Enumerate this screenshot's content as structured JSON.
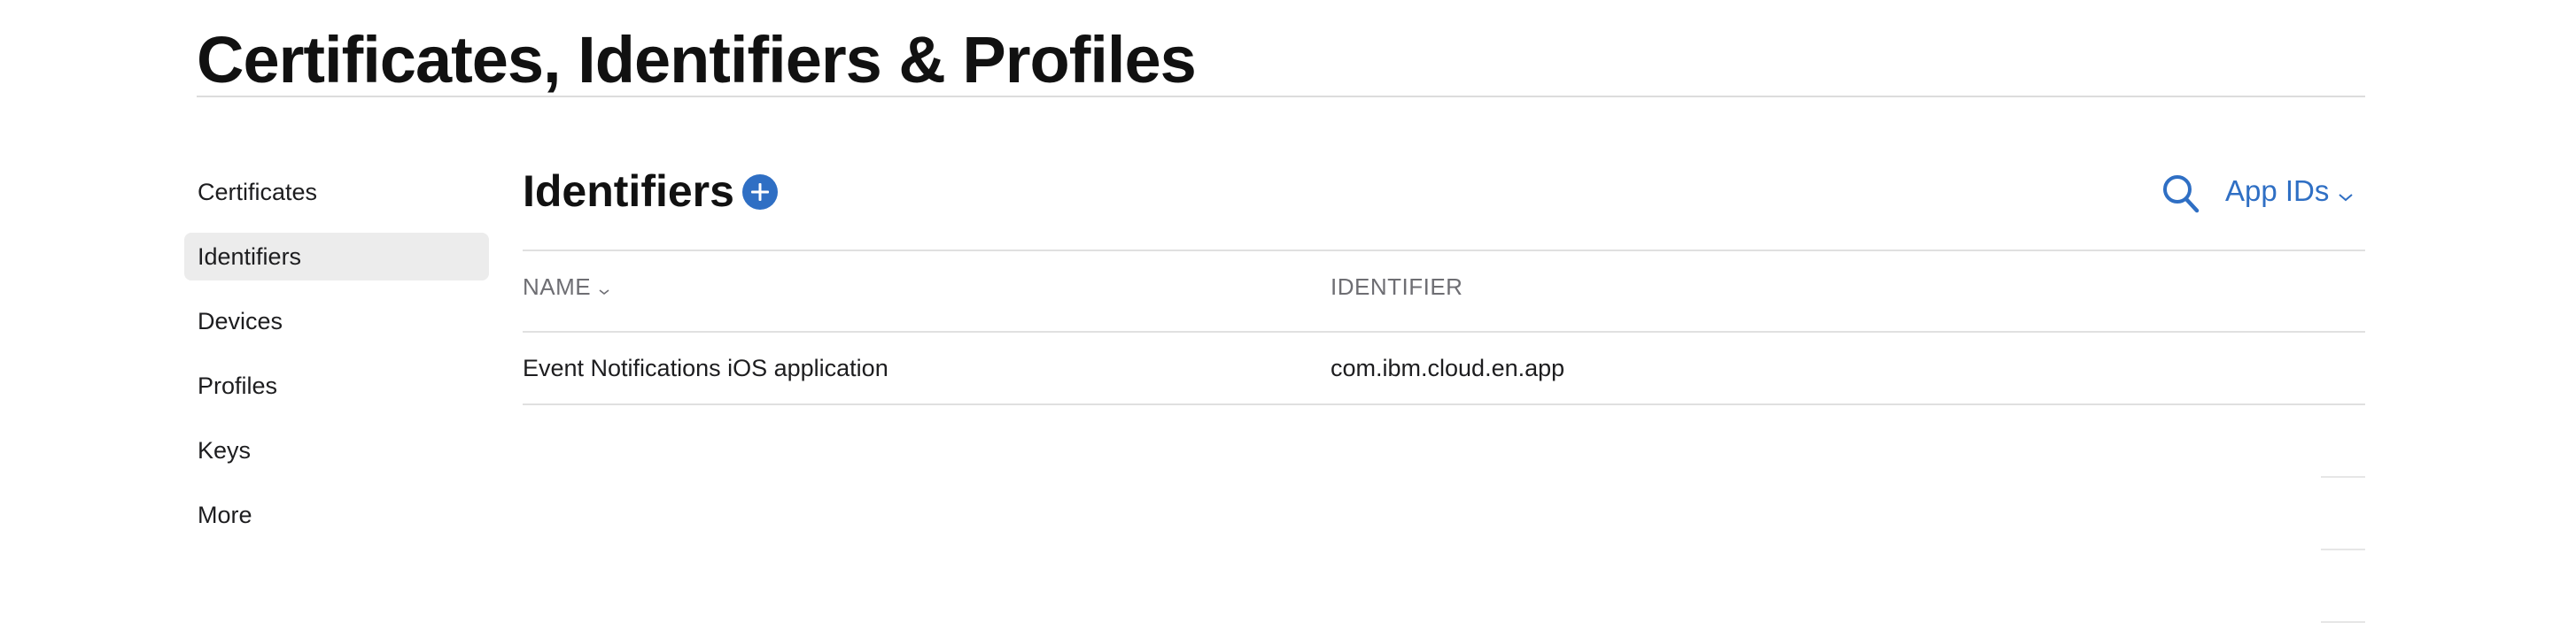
{
  "page": {
    "title": "Certificates, Identifiers & Profiles"
  },
  "sidebar": {
    "items": [
      {
        "label": "Certificates"
      },
      {
        "label": "Identifiers",
        "active": true
      },
      {
        "label": "Devices"
      },
      {
        "label": "Profiles"
      },
      {
        "label": "Keys"
      },
      {
        "label": "More"
      }
    ]
  },
  "main": {
    "title": "Identifiers",
    "add_icon": "plus-circle-icon",
    "search_icon": "search-icon",
    "filter": {
      "selected": "App IDs",
      "icon": "chevron-down-icon"
    },
    "table": {
      "columns": [
        {
          "label": "NAME",
          "sortable": true
        },
        {
          "label": "IDENTIFIER"
        }
      ],
      "rows": [
        {
          "name": "Event Notifications iOS application",
          "identifier": "com.ibm.cloud.en.app"
        }
      ]
    }
  },
  "colors": {
    "accent": "#2f6fc4",
    "active_background": "#ececec",
    "muted_text": "#6e6e73",
    "divider": "#e0e0e0"
  }
}
